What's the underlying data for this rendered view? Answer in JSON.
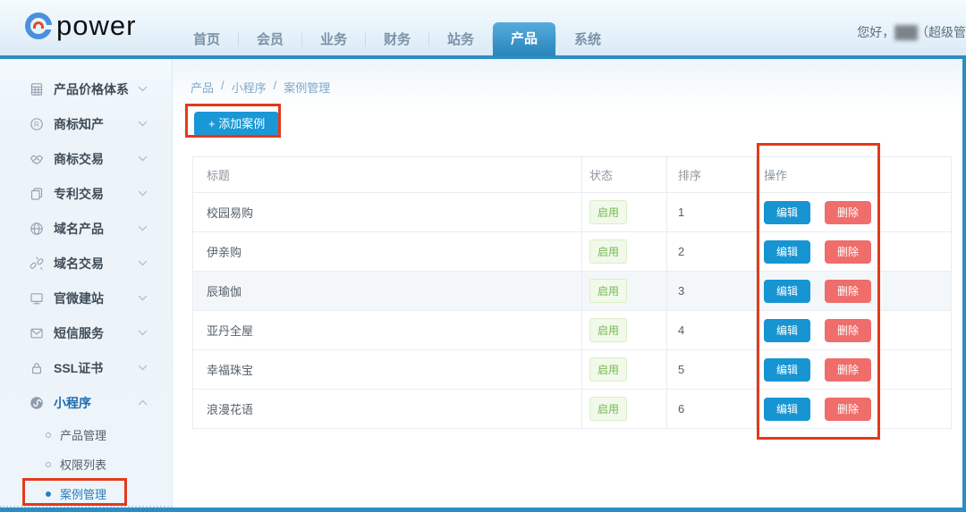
{
  "brand": {
    "logo_text": "power"
  },
  "header": {
    "tabs": [
      "首页",
      "会员",
      "业务",
      "财务",
      "站务",
      "产品",
      "系统"
    ],
    "active_tab": "产品",
    "greeting_prefix": "您好，",
    "greeting_name_redacted": "███",
    "greeting_suffix": "（超级管"
  },
  "sidebar": {
    "items": [
      {
        "icon": "calculator-icon",
        "label": "产品价格体系",
        "expanded": false,
        "active": false
      },
      {
        "icon": "registered-trademark-icon",
        "label": "商标知产",
        "expanded": false,
        "active": false
      },
      {
        "icon": "handshake-icon",
        "label": "商标交易",
        "expanded": false,
        "active": false
      },
      {
        "icon": "copy-documents-icon",
        "label": "专利交易",
        "expanded": false,
        "active": false
      },
      {
        "icon": "globe-icon",
        "label": "域名产品",
        "expanded": false,
        "active": false
      },
      {
        "icon": "broken-link-icon",
        "label": "域名交易",
        "expanded": false,
        "active": false
      },
      {
        "icon": "monitor-icon",
        "label": "官微建站",
        "expanded": false,
        "active": false
      },
      {
        "icon": "envelope-icon",
        "label": "短信服务",
        "expanded": false,
        "active": false
      },
      {
        "icon": "lock-icon",
        "label": "SSL证书",
        "expanded": false,
        "active": false
      },
      {
        "icon": "miniprogram-icon",
        "label": "小程序",
        "expanded": true,
        "active": true
      }
    ],
    "subitems": [
      {
        "label": "产品管理",
        "active": false
      },
      {
        "label": "权限列表",
        "active": false
      },
      {
        "label": "案例管理",
        "active": true
      }
    ]
  },
  "breadcrumb": {
    "items": [
      "产品",
      "小程序",
      "案例管理"
    ],
    "separator": "/"
  },
  "toolbar": {
    "add_button_label": "+ 添加案例"
  },
  "table": {
    "columns": [
      "标题",
      "状态",
      "排序",
      "操作"
    ],
    "rows": [
      {
        "title": "校园易购",
        "status": "启用",
        "order": "1",
        "highlight": false
      },
      {
        "title": "伊亲购",
        "status": "启用",
        "order": "2",
        "highlight": false
      },
      {
        "title": "辰瑜伽",
        "status": "启用",
        "order": "3",
        "highlight": true
      },
      {
        "title": "亚丹全屋",
        "status": "启用",
        "order": "4",
        "highlight": false
      },
      {
        "title": "幸福珠宝",
        "status": "启用",
        "order": "5",
        "highlight": false
      },
      {
        "title": "浪漫花语",
        "status": "启用",
        "order": "6",
        "highlight": false
      }
    ],
    "actions": {
      "edit": "编辑",
      "delete": "删除"
    }
  },
  "colors": {
    "accent_blue": "#2c8cc4",
    "active_tab_blue": "#2a85bd",
    "edit_button": "#1695d2",
    "delete_button": "#ef6d6a",
    "status_green": "#71b94e",
    "annotation_red": "#e23a1b"
  }
}
